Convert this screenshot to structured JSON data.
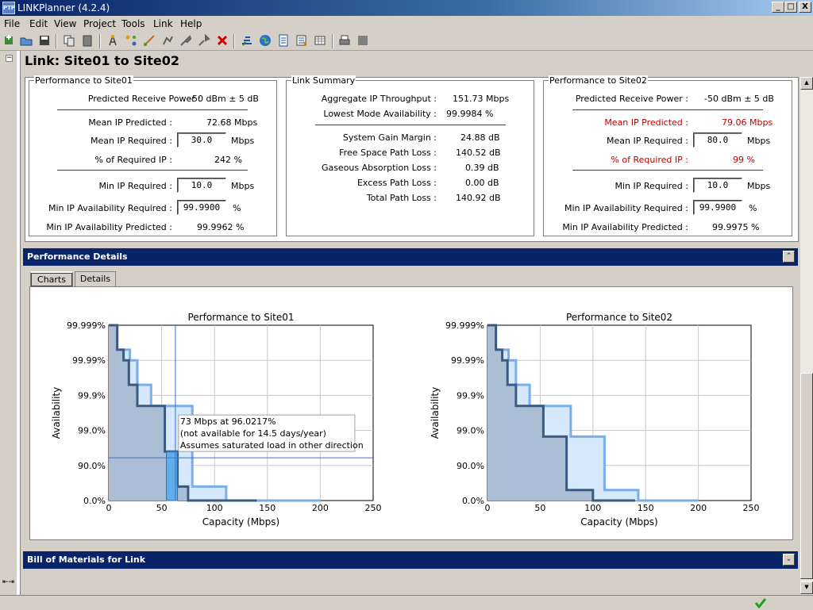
{
  "window": {
    "title": "LINKPlanner (4.2.4)",
    "minimize": "_",
    "maximize": "□",
    "close": "X"
  },
  "menu": [
    "File",
    "Edit",
    "View",
    "Project",
    "Tools",
    "Link",
    "Help"
  ],
  "toolbar_icons": [
    "new-project-icon",
    "open-project-icon",
    "save-icon",
    "copy-icon",
    "paste-icon",
    "add-site-icon",
    "add-link-icon",
    "edit-link-icon",
    "add-pmp-icon",
    "edit-pmp-icon",
    "delete-icon",
    "profile-icon",
    "google-earth-icon",
    "report-icon",
    "bill-of-materials-icon",
    "table-icon",
    "print-icon",
    "stop-icon"
  ],
  "page_title": "Link: Site01 to Site02",
  "perf_site01": {
    "title": "Performance to Site01",
    "predicted_receive_power_label": "Predicted Receive Power :",
    "predicted_receive_power_value": "-50 dBm ± 5 dB",
    "mean_ip_predicted_label": "Mean IP Predicted :",
    "mean_ip_predicted_value": "72.68 Mbps",
    "mean_ip_required_label": "Mean IP Required :",
    "mean_ip_required_value": "30.0",
    "mean_ip_required_unit": "Mbps",
    "pct_required_label": "% of Required IP :",
    "pct_required_value": "242 %",
    "min_ip_required_label": "Min IP Required :",
    "min_ip_required_value": "10.0",
    "min_ip_required_unit": "Mbps",
    "min_avail_required_label": "Min IP Availability Required :",
    "min_avail_required_value": "99.9900",
    "min_avail_required_unit": "%",
    "min_avail_predicted_label": "Min IP Availability Predicted :",
    "min_avail_predicted_value": "99.9962 %"
  },
  "link_summary": {
    "title": "Link Summary",
    "agg_ip_label": "Aggregate IP Throughput :",
    "agg_ip_value": "151.73 Mbps",
    "lowest_mode_label": "Lowest Mode Availability :",
    "lowest_mode_value": "99.9984 %",
    "system_gain_label": "System Gain Margin :",
    "system_gain_value": "24.88 dB",
    "fspl_label": "Free Space Path Loss :",
    "fspl_value": "140.52 dB",
    "gas_label": "Gaseous Absorption Loss :",
    "gas_value": "0.39 dB",
    "excess_label": "Excess Path Loss :",
    "excess_value": "0.00 dB",
    "total_label": "Total Path Loss :",
    "total_value": "140.92 dB"
  },
  "perf_site02": {
    "title": "Performance to Site02",
    "predicted_receive_power_label": "Predicted Receive Power :",
    "predicted_receive_power_value": "-50 dBm ± 5 dB",
    "mean_ip_predicted_label": "Mean IP Predicted :",
    "mean_ip_predicted_value": "79.06 Mbps",
    "mean_ip_required_label": "Mean IP Required :",
    "mean_ip_required_value": "80.0",
    "mean_ip_required_unit": "Mbps",
    "pct_required_label": "% of Required IP :",
    "pct_required_value": "99 %",
    "min_ip_required_label": "Min IP Required :",
    "min_ip_required_value": "10.0",
    "min_ip_required_unit": "Mbps",
    "min_avail_required_label": "Min IP Availability Required :",
    "min_avail_required_value": "99.9900",
    "min_avail_required_unit": "%",
    "min_avail_predicted_label": "Min IP Availability Predicted :",
    "min_avail_predicted_value": "99.9975 %",
    "warning_color": "#c00000"
  },
  "performance_details": {
    "title": "Performance Details",
    "collapse_glyph": "⌃"
  },
  "tabs": [
    {
      "label": "Charts",
      "selected": true
    },
    {
      "label": "Details",
      "selected": false
    }
  ],
  "bill_of_materials": {
    "title": "Bill of Materials for Link",
    "expand_glyph": "⌄"
  },
  "colors": {
    "header_blue": "#0a246a",
    "dark_series": "#3c5a80",
    "light_series": "#79aee8",
    "highlight": "#4aa8f0"
  },
  "chart_data": [
    {
      "type": "area",
      "title": "Performance to Site01",
      "xlabel": "Capacity (Mbps)",
      "ylabel": "Availability",
      "xlim": [
        0,
        250
      ],
      "x_ticks": [
        "0",
        "50",
        "100",
        "150",
        "200",
        "250"
      ],
      "y_scale": "log-unavailability",
      "y_ticks": [
        "99.999%",
        "99.99%",
        "99.9%",
        "99.0%",
        "90.0%",
        "0.0%"
      ],
      "grid": true,
      "series": [
        {
          "capacity_mbps": [
            0,
            8,
            8,
            14,
            14,
            19,
            19,
            27,
            27,
            53,
            53,
            65,
            65,
            75,
            75,
            140
          ],
          "availability_pct": [
            99.999,
            99.999,
            99.995,
            99.995,
            99.99,
            99.99,
            99.95,
            99.95,
            99.8,
            99.8,
            96,
            96,
            60,
            60,
            0,
            0
          ]
        },
        {
          "capacity_mbps": [
            0,
            8,
            8,
            20,
            20,
            27,
            27,
            40,
            40,
            79,
            79,
            111,
            111,
            200
          ],
          "availability_pct": [
            99.999,
            99.999,
            99.995,
            99.995,
            99.99,
            99.99,
            99.95,
            99.95,
            99.8,
            99.8,
            60,
            60,
            0,
            0
          ]
        }
      ],
      "cursor": {
        "capacity_mbps": 63,
        "availability_pct": 96.0217
      },
      "tooltip": [
        "73 Mbps at 96.0217%",
        "(not available for 14.5 days/year)",
        "Assumes saturated load in other direction"
      ]
    },
    {
      "type": "area",
      "title": "Performance to Site02",
      "xlabel": "Capacity (Mbps)",
      "ylabel": "Availability",
      "xlim": [
        0,
        250
      ],
      "x_ticks": [
        "0",
        "50",
        "100",
        "150",
        "200",
        "250"
      ],
      "y_scale": "log-unavailability",
      "y_ticks": [
        "99.999%",
        "99.99%",
        "99.9%",
        "99.0%",
        "90.0%",
        "0.0%"
      ],
      "grid": true,
      "series": [
        {
          "capacity_mbps": [
            0,
            8,
            8,
            14,
            14,
            19,
            19,
            27,
            27,
            53,
            53,
            75,
            75,
            100,
            100,
            140
          ],
          "availability_pct": [
            99.999,
            99.999,
            99.995,
            99.995,
            99.99,
            99.99,
            99.95,
            99.95,
            99.8,
            99.8,
            98.5,
            98.5,
            50,
            50,
            0,
            0
          ]
        },
        {
          "capacity_mbps": [
            0,
            8,
            8,
            20,
            20,
            27,
            27,
            40,
            40,
            79,
            79,
            111,
            111,
            143,
            143,
            200
          ],
          "availability_pct": [
            99.999,
            99.999,
            99.995,
            99.995,
            99.99,
            99.99,
            99.95,
            99.95,
            99.8,
            99.8,
            98.5,
            98.5,
            50,
            50,
            0,
            0
          ]
        }
      ]
    }
  ]
}
